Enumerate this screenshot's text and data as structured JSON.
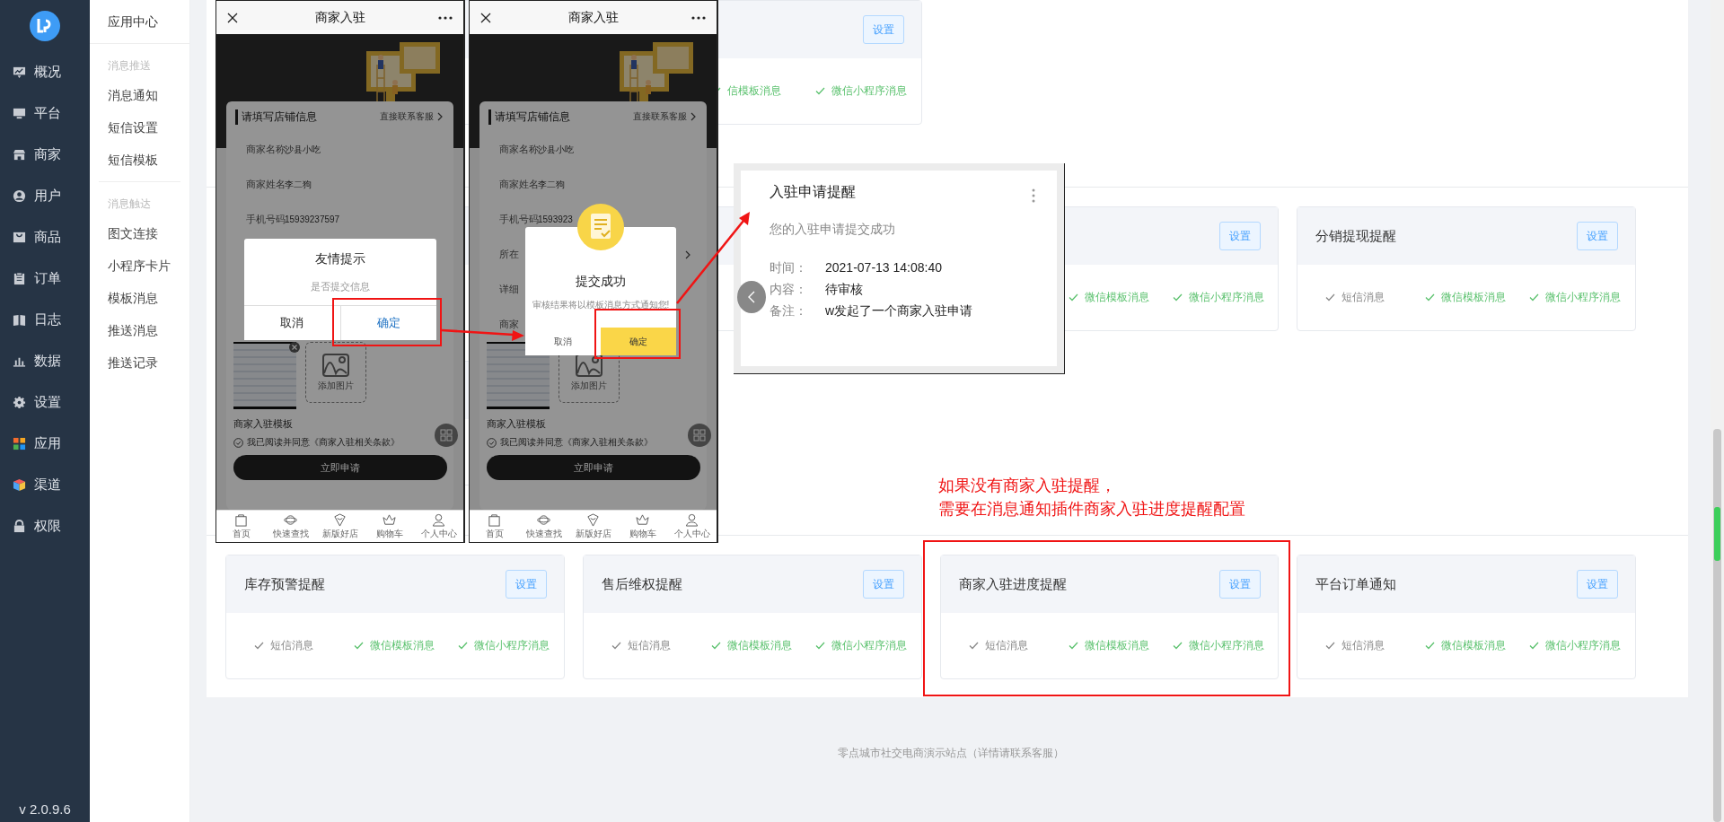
{
  "sidebar": {
    "items": [
      {
        "label": "概况"
      },
      {
        "label": "平台"
      },
      {
        "label": "商家"
      },
      {
        "label": "用户"
      },
      {
        "label": "商品"
      },
      {
        "label": "订单"
      },
      {
        "label": "日志"
      },
      {
        "label": "数据"
      },
      {
        "label": "设置"
      },
      {
        "label": "应用"
      },
      {
        "label": "渠道"
      },
      {
        "label": "权限"
      }
    ],
    "version": "v 2.0.9.6"
  },
  "submenu": {
    "title": "应用中心",
    "groups": [
      {
        "heading": "消息推送",
        "items": [
          "消息通知",
          "短信设置",
          "短信模板"
        ]
      },
      {
        "heading": "消息触达",
        "items": [
          "图文连接",
          "小程序卡片",
          "模板消息",
          "推送消息",
          "推送记录"
        ]
      }
    ]
  },
  "sections": [
    {
      "rows": [
        [
          {
            "kind": "card"
          },
          {
            "kind": "card",
            "button": "设置",
            "messages": [
              {
                "label": "信模板消息",
                "enabled": true
              },
              {
                "label": "微信小程序消息",
                "enabled": true
              }
            ]
          },
          {
            "kind": "empty"
          },
          {
            "kind": "empty"
          }
        ]
      ]
    },
    {
      "rows": [
        [
          {
            "kind": "card"
          },
          {
            "kind": "card"
          },
          {
            "kind": "card",
            "button": "设置",
            "messages": [
              {
                "label": "微信模板消息",
                "enabled": true
              },
              {
                "label": "微信小程序消息",
                "enabled": true
              }
            ]
          },
          {
            "kind": "card",
            "title": "分销提现提醒",
            "button": "设置",
            "messages": [
              {
                "label": "短信消息",
                "enabled": false
              },
              {
                "label": "微信模板消息",
                "enabled": true
              },
              {
                "label": "微信小程序消息",
                "enabled": true
              }
            ]
          }
        ],
        [
          {
            "kind": "card"
          },
          {
            "kind": "empty"
          },
          {
            "kind": "empty"
          },
          {
            "kind": "empty"
          }
        ]
      ]
    },
    {
      "rows": [
        [
          {
            "kind": "card",
            "title": "库存预警提醒",
            "button": "设置",
            "messages": [
              {
                "label": "短信消息",
                "enabled": false
              },
              {
                "label": "微信模板消息",
                "enabled": true
              },
              {
                "label": "微信小程序消息",
                "enabled": true
              }
            ]
          },
          {
            "kind": "card",
            "title": "售后维权提醒",
            "button": "设置",
            "messages": [
              {
                "label": "短信消息",
                "enabled": false
              },
              {
                "label": "微信模板消息",
                "enabled": true
              },
              {
                "label": "微信小程序消息",
                "enabled": true
              }
            ]
          },
          {
            "kind": "card",
            "title": "商家入驻进度提醒",
            "button": "设置",
            "messages": [
              {
                "label": "短信消息",
                "enabled": false
              },
              {
                "label": "微信模板消息",
                "enabled": true
              },
              {
                "label": "微信小程序消息",
                "enabled": true
              }
            ]
          },
          {
            "kind": "card",
            "title": "平台订单通知",
            "button": "设置",
            "messages": [
              {
                "label": "短信消息",
                "enabled": false
              },
              {
                "label": "微信模板消息",
                "enabled": true
              },
              {
                "label": "微信小程序消息",
                "enabled": true
              }
            ]
          }
        ]
      ]
    }
  ],
  "phones": [
    {
      "title": "商家入驻",
      "form_title": "请填写店铺信息",
      "contact": "直接联系客服",
      "fields": [
        {
          "kind": "text",
          "label": "商家名称",
          "value": "沙县小吃"
        },
        {
          "kind": "text",
          "label": "商家姓名",
          "value": "李二狗"
        },
        {
          "kind": "text",
          "label": "手机号码",
          "value": "15939237597"
        }
      ],
      "thumbnail_removable": true,
      "upload_label": "添加图片",
      "template_label": "商家入驻模板",
      "agreement": "我已阅读并同意《商家入驻相关条款》",
      "agreed": true,
      "submit": "立即申请",
      "tabs": [
        "首页",
        "快速查找",
        "新版好店",
        "购物车",
        "个人中心"
      ],
      "dialog": {
        "kind": "confirm",
        "title": "友情提示",
        "message": "是否提交信息",
        "cancel": "取消",
        "confirm": "确定"
      }
    },
    {
      "title": "商家入驻",
      "form_title": "请填写店铺信息",
      "contact": "直接联系客服",
      "fields": [
        {
          "kind": "text",
          "label": "商家名称",
          "value": "沙县小吃"
        },
        {
          "kind": "text",
          "label": "商家姓名",
          "value": "李二狗"
        },
        {
          "kind": "text",
          "label": "手机号码",
          "value": "1593923"
        },
        {
          "kind": "select",
          "label": "所在"
        },
        {
          "kind": "text",
          "label": "详细"
        },
        {
          "kind": "text",
          "label": "商家"
        }
      ],
      "upload_label": "添加图片",
      "template_label": "商家入驻模板",
      "agreement": "我已阅读并同意《商家入驻相关条款》",
      "agreed": true,
      "submit": "立即申请",
      "tabs": [
        "首页",
        "快速查找",
        "新版好店",
        "购物车",
        "个人中心"
      ],
      "dialog": {
        "kind": "success",
        "title": "提交成功",
        "message": "审核结果将以模板消息方式通知您!",
        "cancel": "取消",
        "confirm": "确定"
      }
    }
  ],
  "notification": {
    "title": "入驻申请提醒",
    "subtitle": "您的入驻申请提交成功",
    "rows": [
      {
        "label": "时间：",
        "value": "2021-07-13 14:08:40"
      },
      {
        "label": "内容：",
        "value": "待审核"
      },
      {
        "label": "备注：",
        "value": "w发起了一个商家入驻申请"
      }
    ]
  },
  "note": {
    "lines": [
      "如果没有商家入驻提醒，",
      "需要在消息通知插件商家入驻进度提醒配置"
    ]
  },
  "footer": "零点城市社交电商演示站点（详情请联系客服）"
}
